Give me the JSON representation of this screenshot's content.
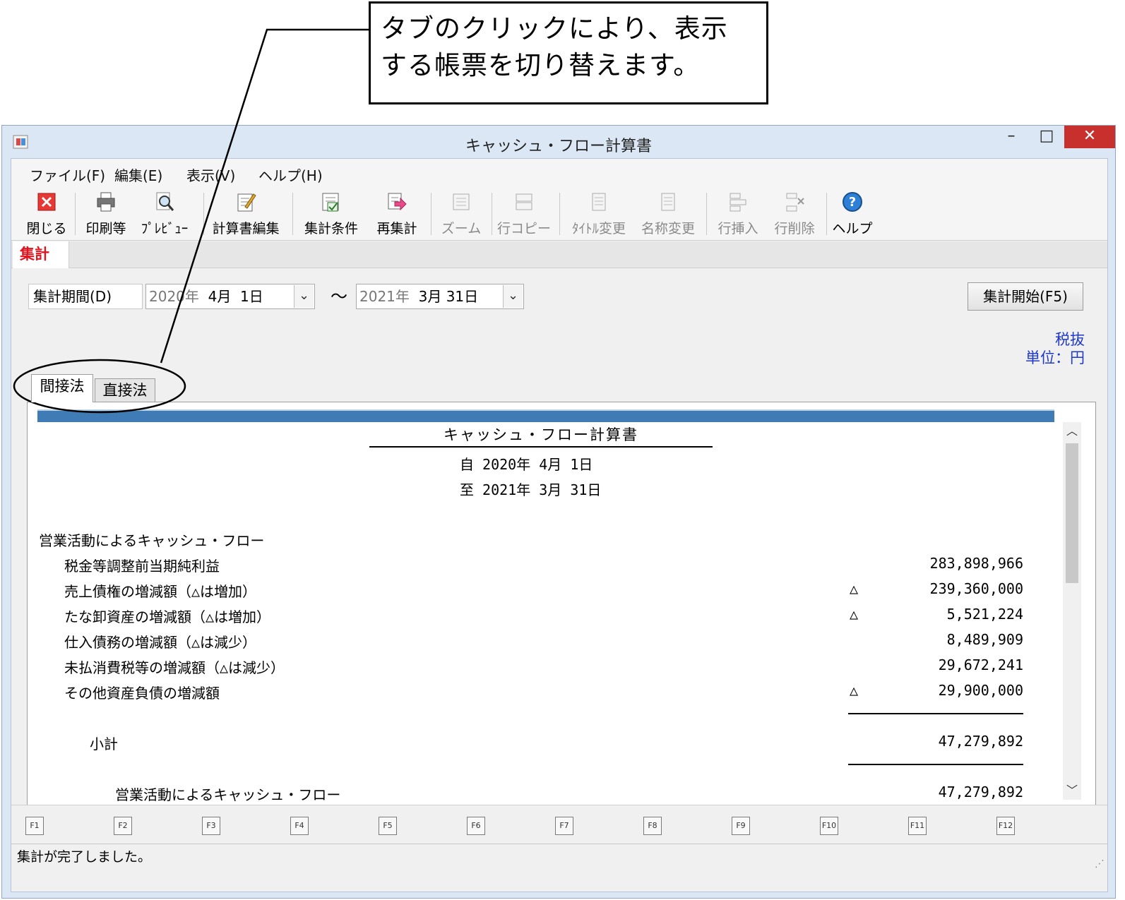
{
  "callout": {
    "line1": "タブのクリックにより、表示",
    "line2": "する帳票を切り替えます。"
  },
  "window": {
    "title": "キャッシュ・フロー計算書",
    "min": "–",
    "max": "□",
    "close": "✕"
  },
  "menu": [
    {
      "label": "ファイル(F)"
    },
    {
      "label": "編集(E)"
    },
    {
      "label": "表示(V)"
    },
    {
      "label": "ヘルプ(H)"
    }
  ],
  "toolbar": {
    "close": "閉じる",
    "print": "印刷等",
    "preview": "ﾌﾟﾚﾋﾞｭｰ",
    "edit": "計算書編集",
    "conditions": "集計条件",
    "recalc": "再集計",
    "zoom": "ズーム",
    "rowcopy": "行コピー",
    "title_change": "ﾀｲﾄﾙ変更",
    "name_change": "名称変更",
    "row_insert": "行挿入",
    "row_delete": "行削除",
    "help": "ヘルプ"
  },
  "tabs": {
    "shuukei": "集計",
    "kansetsu": "間接法",
    "chokusetsu": "直接法"
  },
  "period": {
    "label": "集計期間(D)",
    "from_year": "2020年",
    "from_rest": "  4月  1日",
    "tilde": "～",
    "to_year": "2021年",
    "to_rest": "  3月 31日",
    "run_button": "集計開始(F5)"
  },
  "tax_note": {
    "line1": "税抜",
    "line2": "単位：円"
  },
  "report": {
    "title": "キャッシュ・フロー計算書",
    "from": "自 2020年  4月  1日",
    "to": "至 2021年  3月 31日",
    "section": "営業活動によるキャッシュ・フロー",
    "rows": [
      {
        "label": "税金等調整前当期純利益",
        "tri": "",
        "amount": "283,898,966"
      },
      {
        "label": "売上債権の増減額（△は増加）",
        "tri": "△",
        "amount": "239,360,000"
      },
      {
        "label": "たな卸資産の増減額（△は増加）",
        "tri": "△",
        "amount": "5,521,224"
      },
      {
        "label": "仕入債務の増減額（△は減少）",
        "tri": "",
        "amount": "8,489,909"
      },
      {
        "label": "未払消費税等の増減額（△は減少）",
        "tri": "",
        "amount": "29,672,241"
      },
      {
        "label": "その他資産負債の増減額",
        "tri": "△",
        "amount": "29,900,000"
      }
    ],
    "subtotal_label": "小計",
    "subtotal_amount": "47,279,892",
    "total_label": "営業活動によるキャッシュ・フロー",
    "total_amount": "47,279,892"
  },
  "fkeys": [
    "F1",
    "F2",
    "F3",
    "F4",
    "F5",
    "F6",
    "F7",
    "F8",
    "F9",
    "F10",
    "F11",
    "F12"
  ],
  "status": "集計が完了しました。",
  "colors": {
    "accent_blue": "#3f7bb4",
    "tab_red": "#e0141e",
    "close_red": "#c7302c",
    "note_blue": "#1f39c8"
  }
}
